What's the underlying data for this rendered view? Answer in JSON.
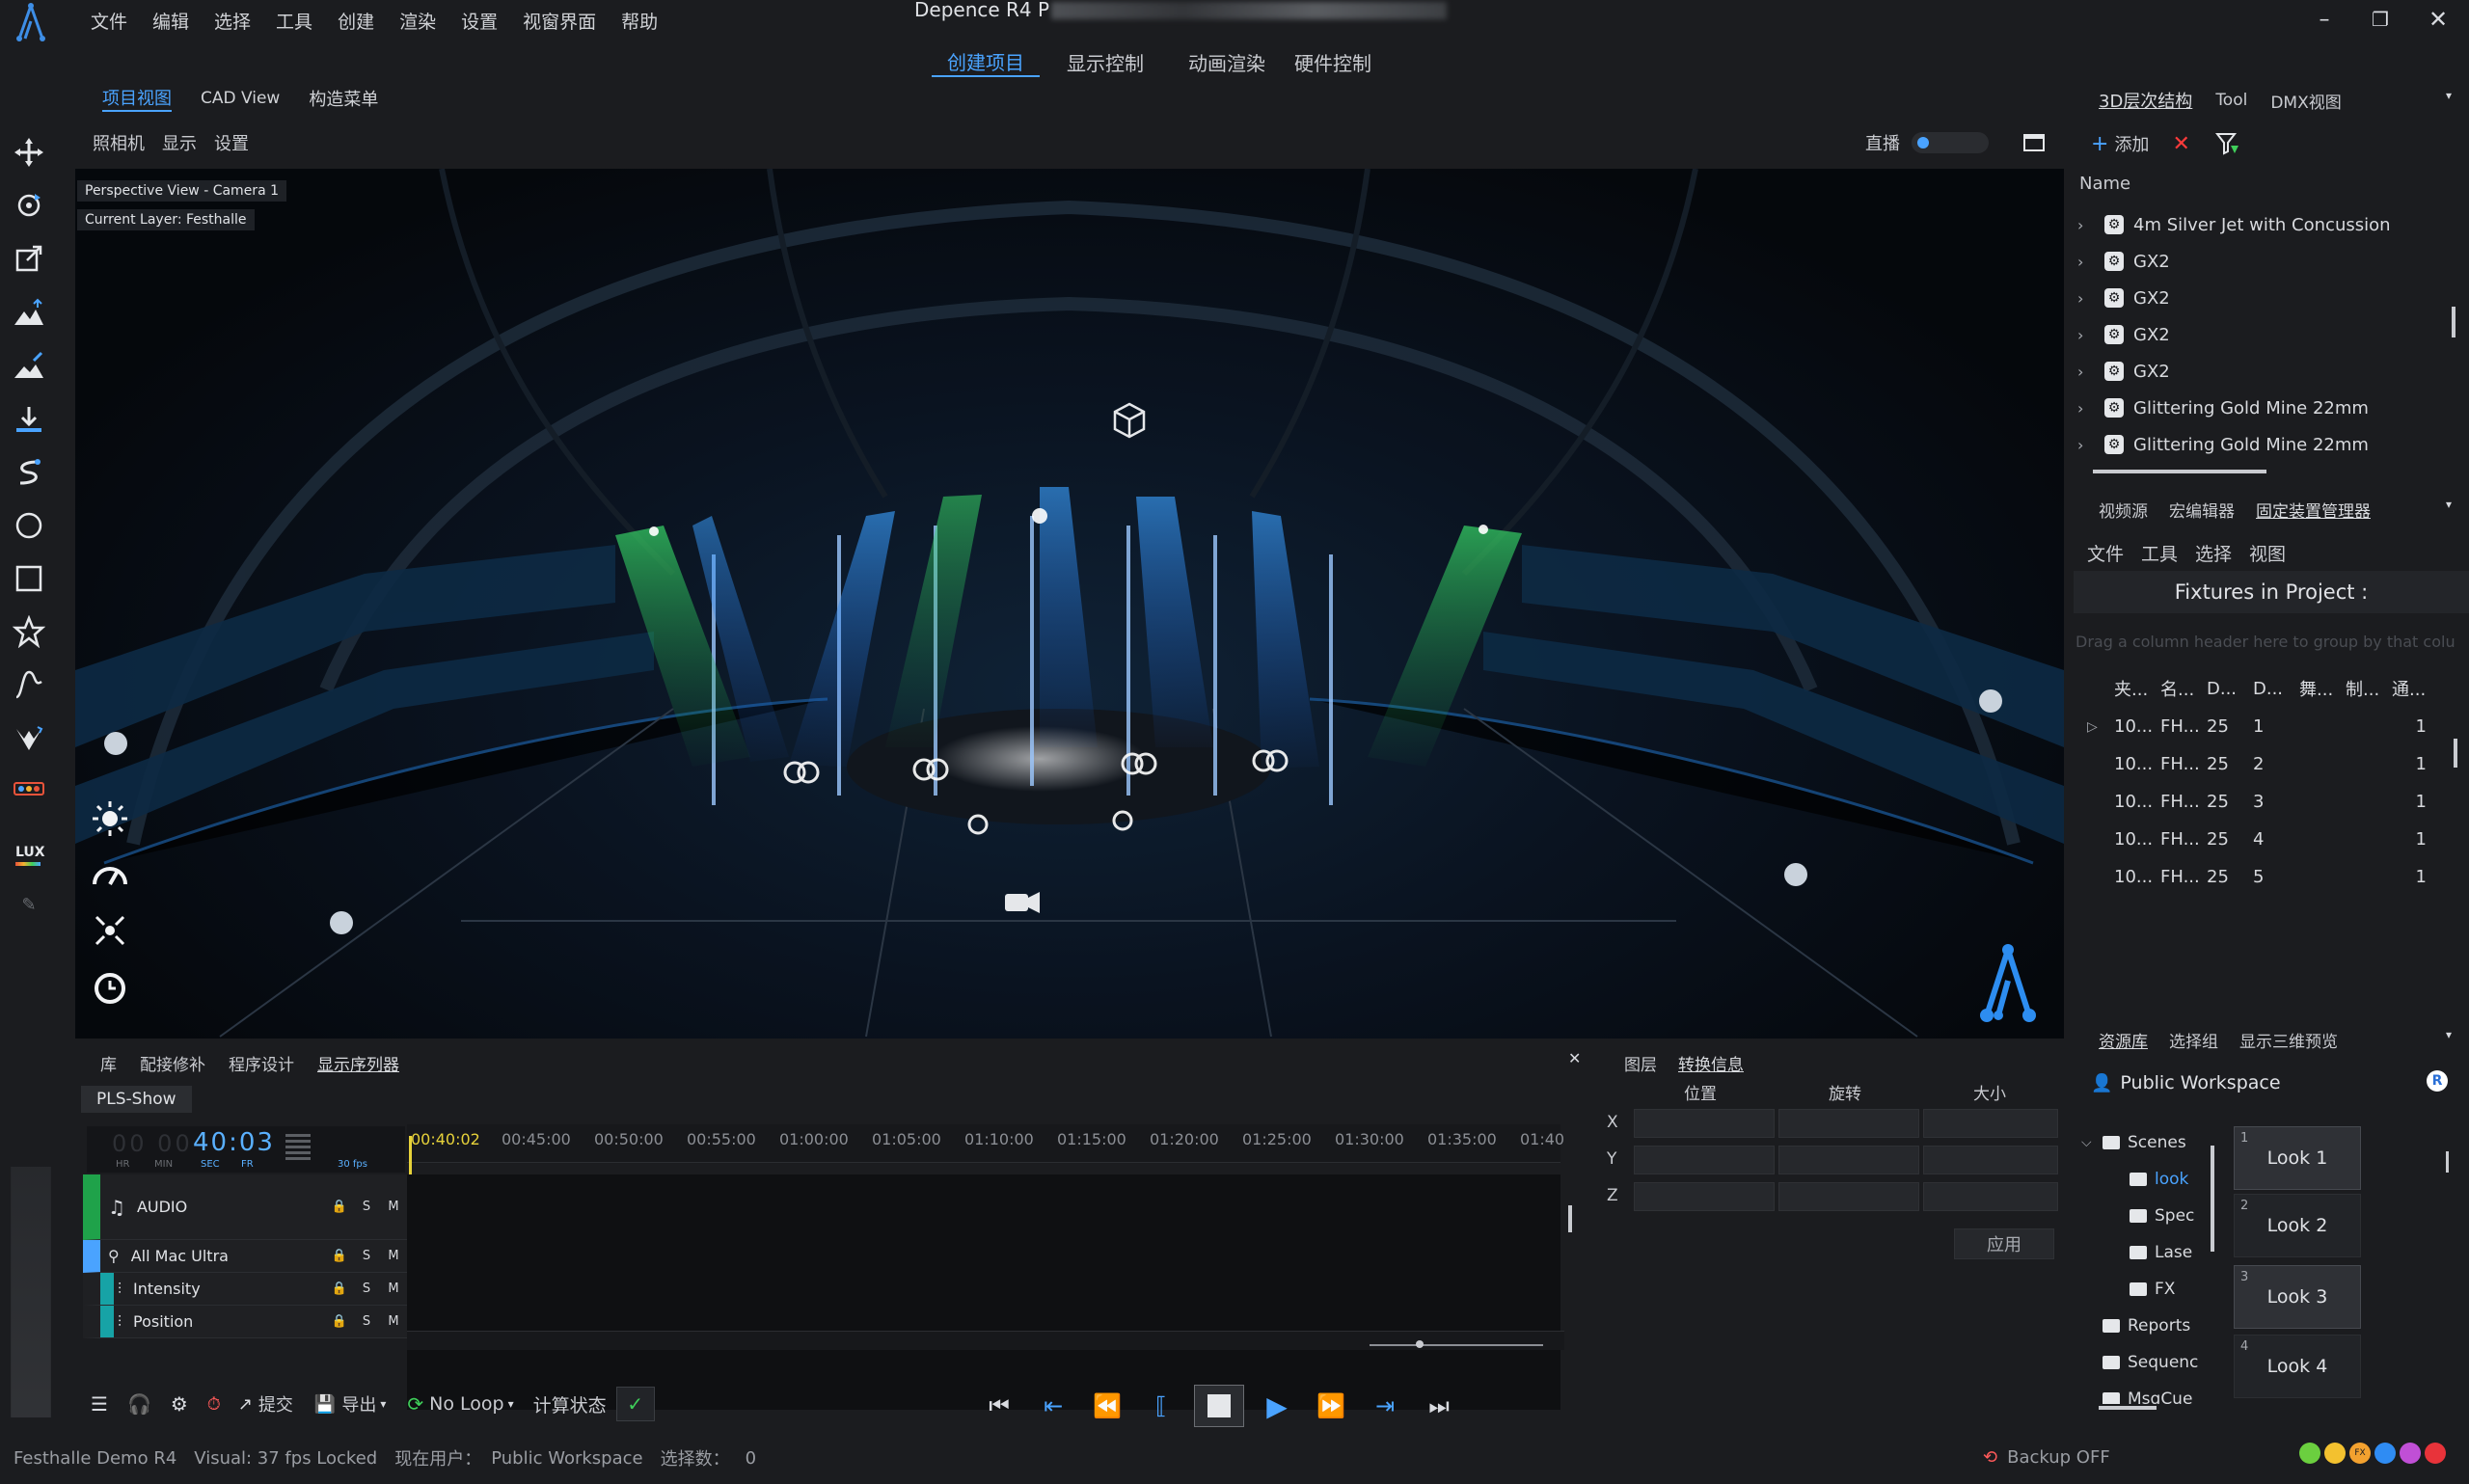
{
  "app": {
    "title": "Depence R4 P",
    "menu": [
      "文件",
      "编辑",
      "选择",
      "工具",
      "创建",
      "渲染",
      "设置",
      "视窗界面",
      "帮助"
    ],
    "main_tabs": [
      "创建项目",
      "显示控制",
      "动画渲染",
      "硬件控制"
    ],
    "active_main_tab": 0
  },
  "viewport": {
    "tabs": [
      "项目视图",
      "CAD View",
      "构造菜单"
    ],
    "sub_menu": [
      "照相机",
      "显示",
      "设置"
    ],
    "live_label": "直播",
    "overlay_camera": "Perspective View - Camera 1",
    "overlay_layer": "Current Layer: Festhalle"
  },
  "left_toolbar": {
    "icons": [
      "move-icon",
      "rotate-icon",
      "scale-icon",
      "terrain-icon",
      "terrain-edit-icon",
      "import-icon",
      "spline-icon",
      "circle-icon",
      "rectangle-icon",
      "star-icon",
      "curve-icon",
      "mesh-icon",
      "truss-icon"
    ],
    "lux_label": "LUX"
  },
  "hierarchy": {
    "tabs": [
      "3D层次结构",
      "Tool",
      "DMX视图"
    ],
    "add_label": "添加",
    "column_name": "Name",
    "items": [
      "4m Silver Jet with Concussion",
      "GX2",
      "GX2",
      "GX2",
      "GX2",
      "Glittering Gold Mine 22mm",
      "Glittering Gold Mine 22mm"
    ]
  },
  "fixtures": {
    "tabs": [
      "视频源",
      "宏编辑器",
      "固定装置管理器"
    ],
    "sub_menu": [
      "文件",
      "工具",
      "选择",
      "视图"
    ],
    "title": "Fixtures in Project :",
    "group_hint": "Drag a column header here to group by that colu",
    "headers": [
      "夹...",
      "名...",
      "D...",
      "D...",
      "舞...",
      "制...",
      "通..."
    ],
    "rows": [
      [
        "10...",
        "FH...",
        "25",
        "1",
        "",
        "",
        "1"
      ],
      [
        "10...",
        "FH...",
        "25",
        "2",
        "",
        "",
        "1"
      ],
      [
        "10...",
        "FH...",
        "25",
        "3",
        "",
        "",
        "1"
      ],
      [
        "10...",
        "FH...",
        "25",
        "4",
        "",
        "",
        "1"
      ],
      [
        "10...",
        "FH...",
        "25",
        "5",
        "",
        "",
        "1"
      ]
    ]
  },
  "resources": {
    "tabs": [
      "资源库",
      "选择组",
      "显示三维预览"
    ],
    "workspace": "Public Workspace",
    "badge": "R",
    "tree": [
      {
        "label": "Scenes",
        "level": 0,
        "expanded": true
      },
      {
        "label": "look",
        "level": 1,
        "selected": true
      },
      {
        "label": "Spec",
        "level": 1
      },
      {
        "label": "Lase",
        "level": 1
      },
      {
        "label": "FX",
        "level": 1
      },
      {
        "label": "Reports",
        "level": 0
      },
      {
        "label": "Sequenc",
        "level": 0
      },
      {
        "label": "MsgCue",
        "level": 0
      }
    ],
    "looks": [
      {
        "num": "1",
        "label": "Look 1"
      },
      {
        "num": "2",
        "label": "Look 2"
      },
      {
        "num": "3",
        "label": "Look 3"
      },
      {
        "num": "4",
        "label": "Look 4"
      }
    ]
  },
  "timeline": {
    "tabs": [
      "库",
      "配接修补",
      "程序设计",
      "显示序列器"
    ],
    "show_name": "PLS-Show",
    "timecode": "40:03",
    "timecode_units": [
      "HR",
      "MIN",
      "SEC",
      "FR"
    ],
    "fps_label": "30 fps",
    "ruler_start": "00:40:02",
    "ruler_ticks": [
      "00:45:00",
      "00:50:00",
      "00:55:00",
      "01:00:00",
      "01:05:00",
      "01:10:00",
      "01:15:00",
      "01:20:00",
      "01:25:00",
      "01:30:00",
      "01:35:00",
      "01:40"
    ],
    "tracks": [
      {
        "name": "AUDIO",
        "icon": "music-note-icon"
      },
      {
        "name": "All Mac Ultra",
        "icon": "fixture-icon"
      },
      {
        "name": "Intensity",
        "icon": "fader-icon"
      },
      {
        "name": "Position",
        "icon": "fader-icon"
      }
    ],
    "lsm": [
      "S",
      "M"
    ]
  },
  "transform": {
    "tabs": [
      "图层",
      "转换信息"
    ],
    "headers": [
      "位置",
      "旋转",
      "大小"
    ],
    "axes": [
      "X",
      "Y",
      "Z"
    ],
    "apply_label": "应用"
  },
  "bottom_bar": {
    "submit_label": "提交",
    "export_label": "导出",
    "loop_label": "No Loop",
    "calc_label": "计算状态"
  },
  "status": {
    "project": "Festhalle Demo R4",
    "visual": "Visual: 37 fps Locked",
    "current_user_label": "现在用户：",
    "current_user": "Public Workspace",
    "selection_label": "选择数：",
    "selection_count": "0",
    "backup": "Backup OFF"
  },
  "colors": {
    "accent": "#4aa3ff",
    "panel": "#1b1c1f",
    "green": "#1fa24a",
    "teal": "#17a3a6"
  }
}
